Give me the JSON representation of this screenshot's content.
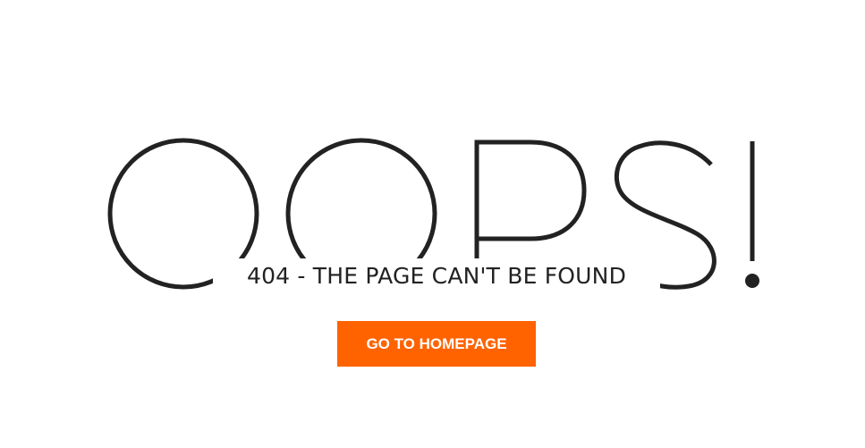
{
  "heading": {
    "text": "OOPS!"
  },
  "subtitle": {
    "text": "404 - THE PAGE CAN'T BE FOUND"
  },
  "button": {
    "label": "GO TO HOMEPAGE"
  },
  "colors": {
    "background": "#ffffff",
    "text": "#222222",
    "accent": "#ff6300",
    "button_text": "#ffffff"
  }
}
